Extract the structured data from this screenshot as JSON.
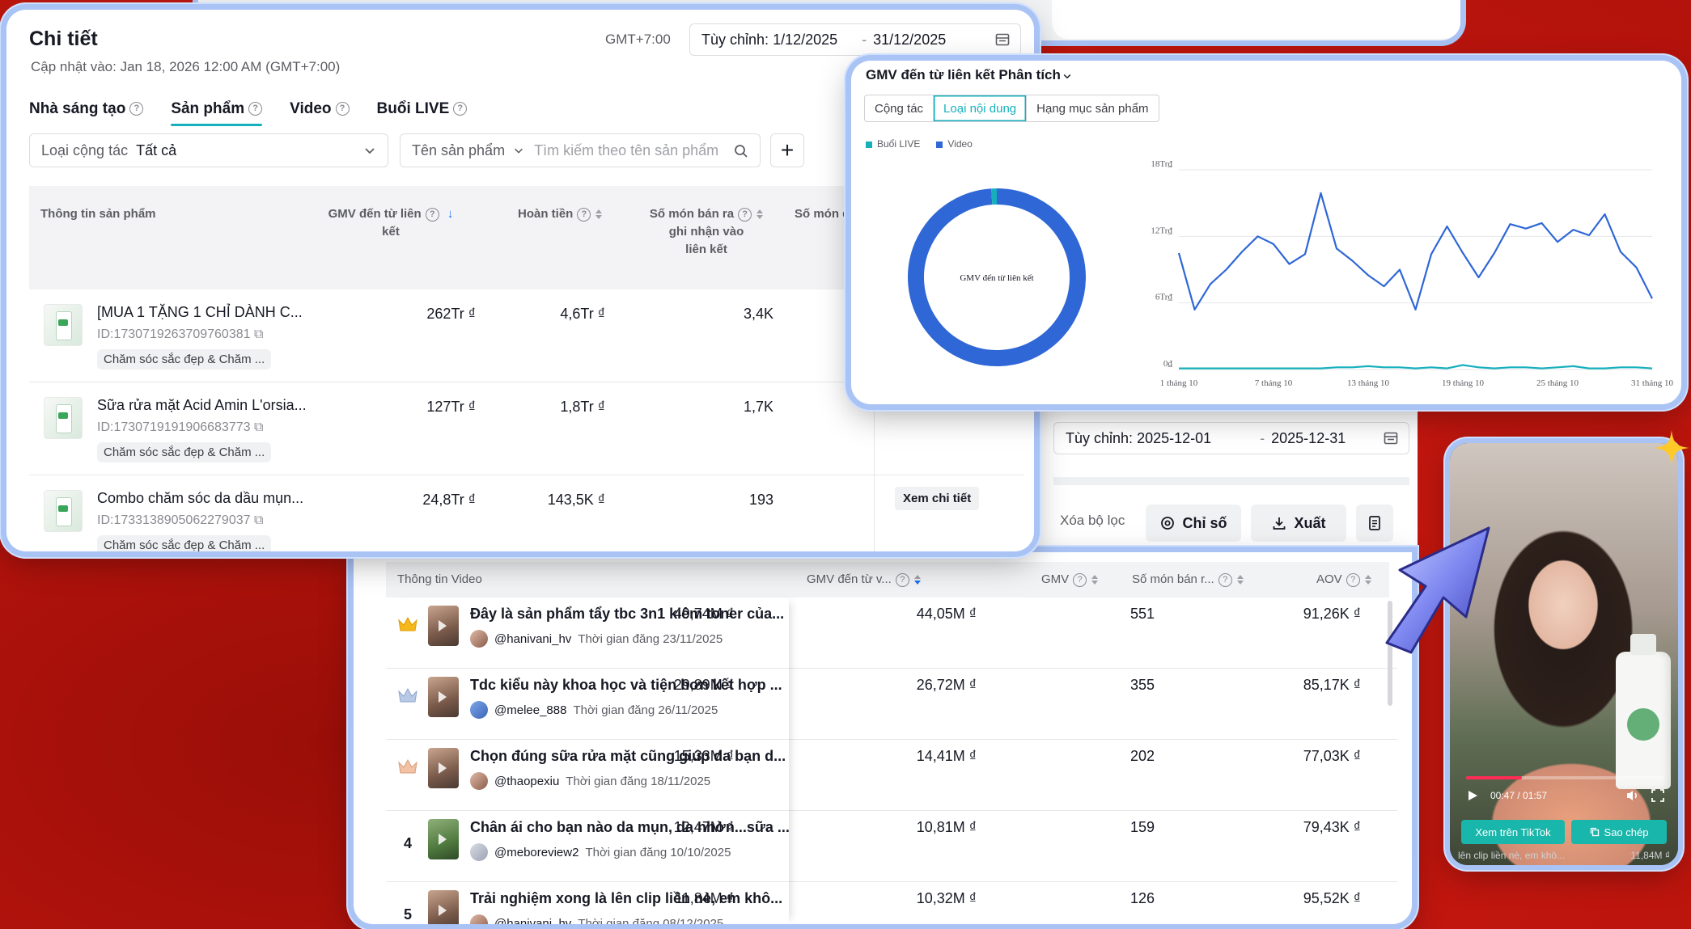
{
  "detail": {
    "title": "Chi tiết",
    "updated": "Cập nhật vào: Jan 18, 2026 12:00 AM (GMT+7:00)",
    "timezone": "GMT+7:00",
    "date_range": {
      "label": "Tùy chỉnh:",
      "start": "1/12/2025",
      "end": "31/12/2025"
    },
    "tabs": [
      "Nhà sáng tạo",
      "Sản phẩm",
      "Video",
      "Buổi LIVE"
    ],
    "active_tab": "Sản phẩm",
    "filter_collab": {
      "label": "Loại cộng tác",
      "value": "Tất cả"
    },
    "filter_product": {
      "label": "Tên sản phẩm",
      "placeholder": "Tìm kiếm theo tên sản phẩm"
    },
    "add_button": "+",
    "columns": {
      "product_info": "Thông tin sản phẩm",
      "gmv_link_1": "GMV đến từ liên",
      "gmv_link_2": "kết",
      "refund": "Hoàn tiền",
      "items_sold_1": "Số món bán ra",
      "items_sold_2": "ghi nhận vào",
      "items_sold_3": "liên kết",
      "items_other": "Số món đã"
    },
    "rows": [
      {
        "name": "[MUA 1 TẶNG 1 CHỈ DÀNH C...",
        "id": "ID:1730719263709760381",
        "category": "Chăm sóc sắc đẹp & Chăm ...",
        "gmv": "262Tr ₫",
        "refund": "4,6Tr ₫",
        "sold": "3,4K",
        "action": ""
      },
      {
        "name": "Sữa rửa mặt Acid Amin L'orsia...",
        "id": "ID:1730719191906683773",
        "category": "Chăm sóc sắc đẹp & Chăm ...",
        "gmv": "127Tr ₫",
        "refund": "1,8Tr ₫",
        "sold": "1,7K",
        "action": ""
      },
      {
        "name": "Combo chăm sóc da dầu mụn...",
        "id": "ID:1733138905062279037",
        "category": "Chăm sóc sắc đẹp & Chăm ...",
        "gmv": "24,8Tr ₫",
        "refund": "143,5K ₫",
        "sold": "193",
        "action": "Xem chi tiết"
      }
    ]
  },
  "chart_panel": {
    "title": "GMV đến từ liên kết Phân tích",
    "segments": [
      "Cộng tác",
      "Loại nội dung",
      "Hạng mục sản phẩm"
    ],
    "active_segment": "Loại nội dung",
    "legend": [
      {
        "name": "Buổi LIVE",
        "color": "#16b0bd"
      },
      {
        "name": "Video",
        "color": "#2f67d6"
      }
    ]
  },
  "chart_data": [
    {
      "type": "pie",
      "center_label": "GMV đến từ liên kết",
      "slices": [
        {
          "name": "Video",
          "value": 99,
          "color": "#2f67d6"
        },
        {
          "name": "Buổi LIVE",
          "value": 1,
          "color": "#16b0bd"
        }
      ]
    },
    {
      "type": "line",
      "x": [
        "1 tháng 10",
        "2",
        "3",
        "4",
        "5",
        "6",
        "7 tháng 10",
        "8",
        "9",
        "10",
        "11",
        "12",
        "13 tháng 10",
        "14",
        "15",
        "16",
        "17",
        "18",
        "19 tháng 10",
        "20",
        "21",
        "22",
        "23",
        "24",
        "25 tháng 10",
        "26",
        "27",
        "28",
        "29",
        "30",
        "31 tháng 10"
      ],
      "x_ticks": [
        "1 tháng 10",
        "7 tháng 10",
        "13 tháng 10",
        "19 tháng 10",
        "25 tháng 10",
        "31 tháng 10"
      ],
      "y_ticks": [
        "0₫",
        "6Tr₫",
        "12Tr₫",
        "18Tr₫"
      ],
      "ylim": [
        0,
        18
      ],
      "grid": true,
      "series": [
        {
          "name": "Video",
          "color": "#2f67d6",
          "values": [
            10.5,
            5.4,
            7.7,
            9.0,
            10.6,
            12.0,
            11.3,
            9.5,
            10.4,
            15.9,
            10.9,
            9.8,
            8.5,
            7.5,
            9.0,
            5.4,
            10.4,
            12.9,
            10.5,
            8.3,
            10.5,
            13.1,
            12.7,
            13.2,
            11.5,
            12.6,
            12.1,
            14.0,
            10.6,
            9.2,
            6.4
          ]
        },
        {
          "name": "Buổi LIVE",
          "color": "#16b0bd",
          "values": [
            0.1,
            0.1,
            0.1,
            0.1,
            0.1,
            0.1,
            0.1,
            0.1,
            0.1,
            0.1,
            0.2,
            0.2,
            0.3,
            0.2,
            0.2,
            0.1,
            0.2,
            0.1,
            0.4,
            0.2,
            0.1,
            0.2,
            0.2,
            0.1,
            0.2,
            0.3,
            0.1,
            0.1,
            0.2,
            0.2,
            0.1
          ]
        }
      ]
    }
  ],
  "filter_strip": {
    "date_range": {
      "label": "Tùy chỉnh:",
      "start": "2025-12-01",
      "end": "2025-12-31"
    },
    "clear": "Xóa bộ lọc",
    "metrics": "Chỉ số",
    "export": "Xuất"
  },
  "videos": {
    "columns": {
      "info": "Thông tin Video",
      "gmv_link": "GMV đến từ v...",
      "gmv": "GMV",
      "sold": "Số món bán r...",
      "aov": "AOV"
    },
    "rows": [
      {
        "rank": "",
        "crown": "gold",
        "title": "Đây là sản phẩm tẩy tbc 3n1 kiêm toner của...",
        "user": "@hanivani_hv",
        "posted": "Thời gian đăng 23/11/2025",
        "gmv_link": "49,74M ₫",
        "gmv": "44,05M ₫",
        "sold": "551",
        "aov": "91,26K ₫"
      },
      {
        "rank": "",
        "crown": "silver",
        "title": "Tdc kiểu này khoa học và tiện hơn kết hợp ...",
        "user": "@melee_888",
        "posted": "Thời gian đăng 26/11/2025",
        "gmv_link": "29,89M ₫",
        "gmv": "26,72M ₫",
        "sold": "355",
        "aov": "85,17K ₫"
      },
      {
        "rank": "",
        "crown": "bronze",
        "title": "Chọn đúng sữa rửa mặt cũng giúp da bạn d...",
        "user": "@thaopexiu",
        "posted": "Thời gian đăng 18/11/2025",
        "gmv_link": "15,33M ₫",
        "gmv": "14,41M ₫",
        "sold": "202",
        "aov": "77,03K ₫"
      },
      {
        "rank": "4",
        "crown": "",
        "title": "Chân ái cho bạn nào da mụn, da nhờn...sữa ...",
        "user": "@meboreview2",
        "posted": "Thời gian đăng 10/10/2025",
        "gmv_link": "12,47M ₫",
        "gmv": "10,81M ₫",
        "sold": "159",
        "aov": "79,43K ₫"
      },
      {
        "rank": "5",
        "crown": "",
        "title": "Trải nghiệm xong là lên clip liền nè, em khô...",
        "user": "@hanivani_hv",
        "posted": "Thời gian đăng 08/12/2025",
        "gmv_link": "11,84M ₫",
        "gmv": "10,32M ₫",
        "sold": "126",
        "aov": "95,52K ₫"
      }
    ]
  },
  "phone": {
    "time": "00:47 / 01:57",
    "progress": 0.28,
    "btn_tiktok": "Xem trên TikTok",
    "btn_copy": "Sao chép",
    "under_left": "lên clip liền nè, em khô...",
    "under_right": "11,84M ₫"
  }
}
